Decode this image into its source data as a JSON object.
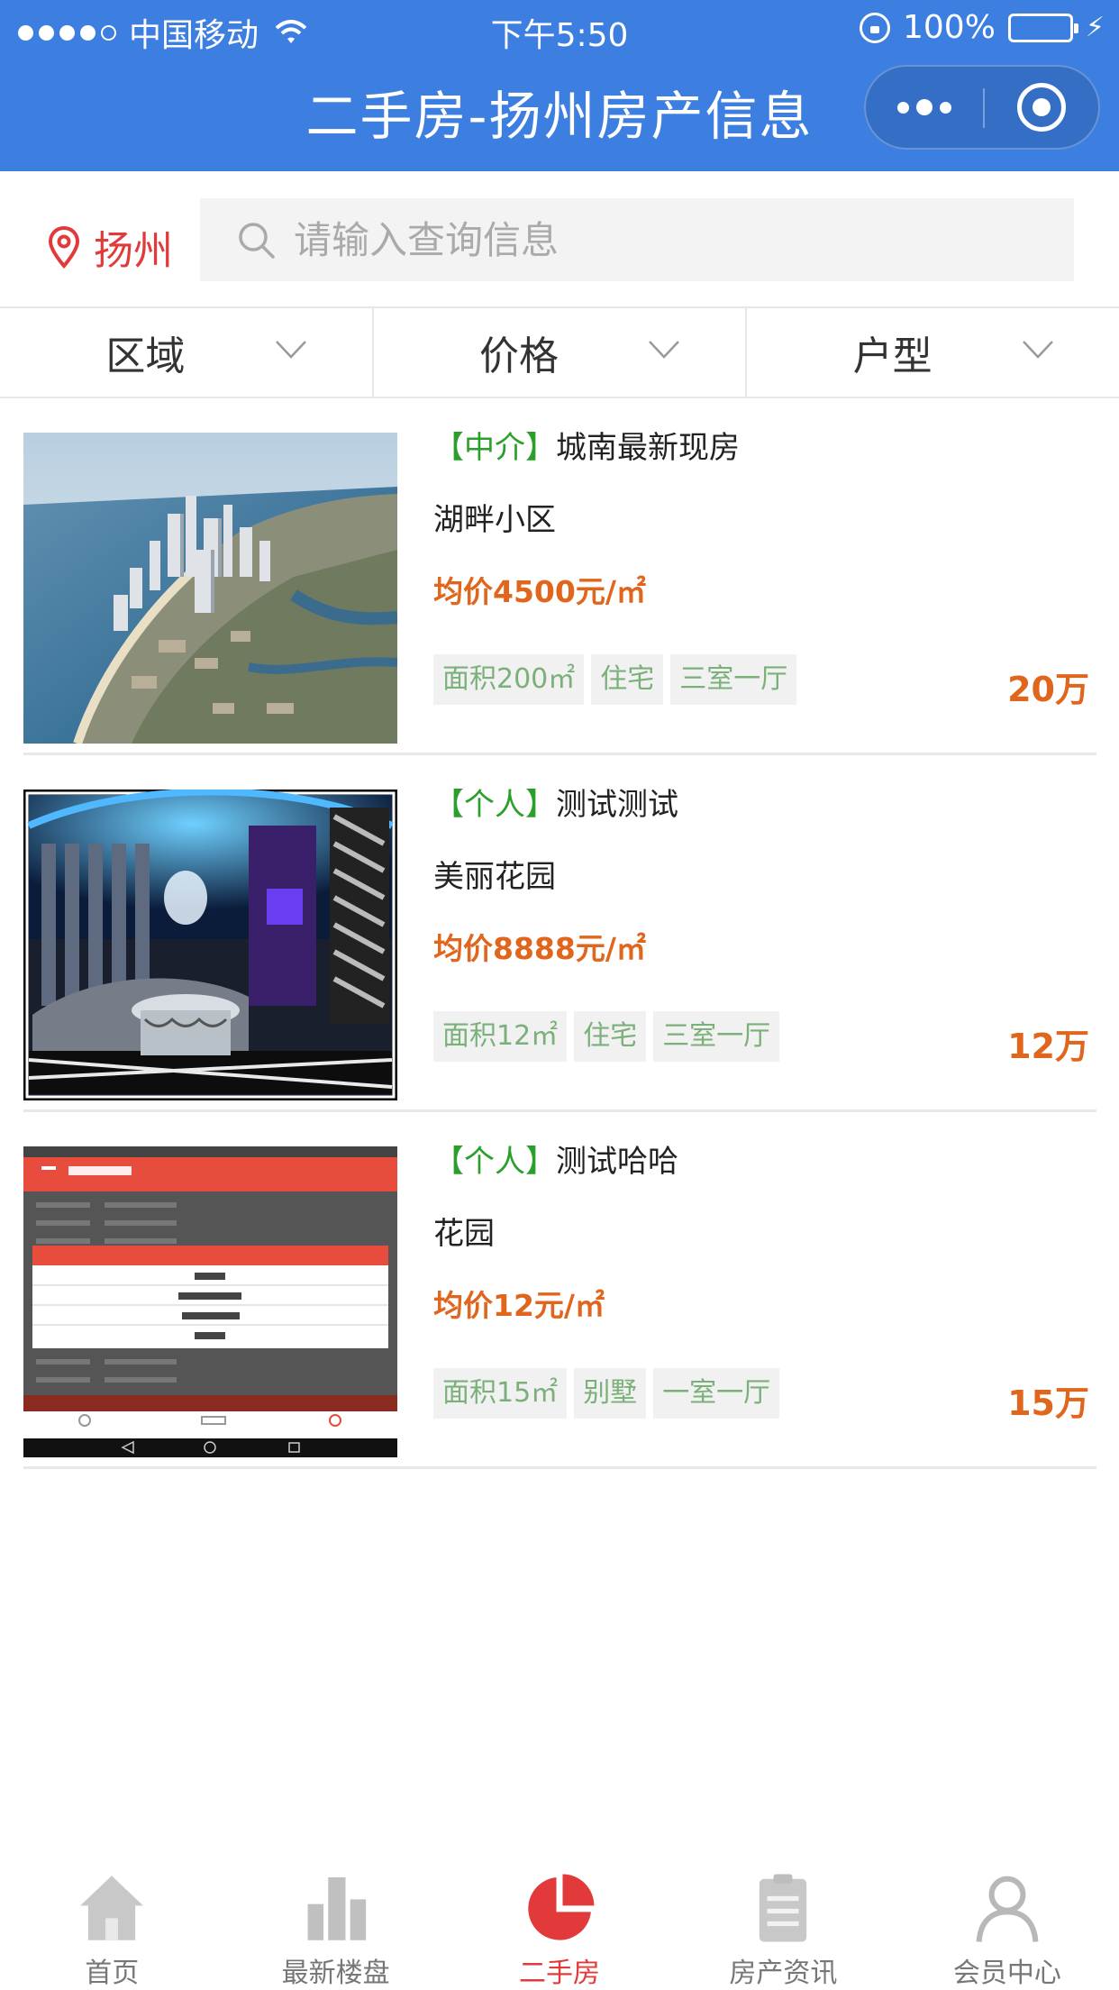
{
  "status_bar": {
    "carrier": "中国移动",
    "time": "下午5:50",
    "battery": "100%"
  },
  "nav": {
    "title": "二手房-扬州房产信息",
    "more_icon": "more-icon",
    "close_icon": "target-icon"
  },
  "search": {
    "city": "扬州",
    "placeholder": "请输入查询信息",
    "value": ""
  },
  "filters": [
    {
      "label": "区域"
    },
    {
      "label": "价格"
    },
    {
      "label": "户型"
    }
  ],
  "listings": [
    {
      "tag": "【中介】",
      "title": "城南最新现房",
      "community": "湖畔小区",
      "avg_price": "均价4500元/㎡",
      "area": "面积200㎡",
      "type": "住宅",
      "layout": "三室一厅",
      "price": "20万",
      "image": "aerial-city-photo"
    },
    {
      "tag": "【个人】",
      "title": "测试测试",
      "community": "美丽花园",
      "avg_price": "均价8888元/㎡",
      "area": "面积12㎡",
      "type": "住宅",
      "layout": "三室一厅",
      "price": "12万",
      "image": "ktv-room-photo"
    },
    {
      "tag": "【个人】",
      "title": "测试哈哈",
      "community": "花园",
      "avg_price": "均价12元/㎡",
      "area": "面积15㎡",
      "type": "别墅",
      "layout": "一室一厅",
      "price": "15万",
      "image": "app-screenshot-photo"
    }
  ],
  "tabbar": [
    {
      "label": "首页",
      "icon": "home-icon"
    },
    {
      "label": "最新楼盘",
      "icon": "buildings-icon"
    },
    {
      "label": "二手房",
      "icon": "pie-icon",
      "active": true
    },
    {
      "label": "房产资讯",
      "icon": "clipboard-icon"
    },
    {
      "label": "会员中心",
      "icon": "user-icon"
    }
  ],
  "colors": {
    "nav_blue": "#3d7ee1",
    "accent_red": "#e23a3a",
    "price_orange": "#e0651d",
    "tag_green": "#2aa02a"
  }
}
